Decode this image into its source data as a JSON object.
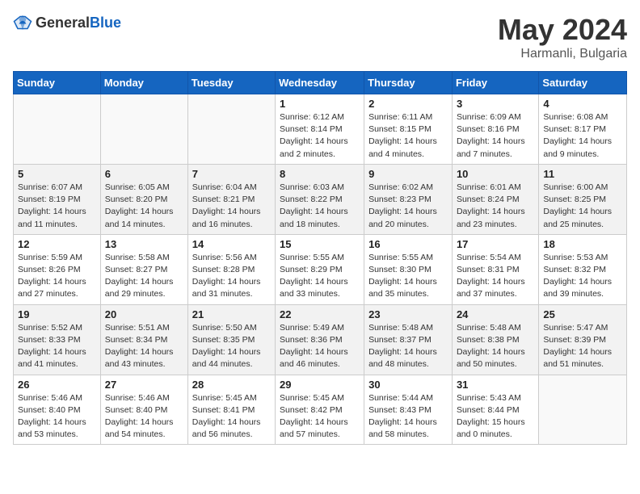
{
  "header": {
    "logo_general": "General",
    "logo_blue": "Blue",
    "month": "May 2024",
    "location": "Harmanli, Bulgaria"
  },
  "weekdays": [
    "Sunday",
    "Monday",
    "Tuesday",
    "Wednesday",
    "Thursday",
    "Friday",
    "Saturday"
  ],
  "weeks": [
    [
      {
        "day": "",
        "info": ""
      },
      {
        "day": "",
        "info": ""
      },
      {
        "day": "",
        "info": ""
      },
      {
        "day": "1",
        "info": "Sunrise: 6:12 AM\nSunset: 8:14 PM\nDaylight: 14 hours\nand 2 minutes."
      },
      {
        "day": "2",
        "info": "Sunrise: 6:11 AM\nSunset: 8:15 PM\nDaylight: 14 hours\nand 4 minutes."
      },
      {
        "day": "3",
        "info": "Sunrise: 6:09 AM\nSunset: 8:16 PM\nDaylight: 14 hours\nand 7 minutes."
      },
      {
        "day": "4",
        "info": "Sunrise: 6:08 AM\nSunset: 8:17 PM\nDaylight: 14 hours\nand 9 minutes."
      }
    ],
    [
      {
        "day": "5",
        "info": "Sunrise: 6:07 AM\nSunset: 8:19 PM\nDaylight: 14 hours\nand 11 minutes."
      },
      {
        "day": "6",
        "info": "Sunrise: 6:05 AM\nSunset: 8:20 PM\nDaylight: 14 hours\nand 14 minutes."
      },
      {
        "day": "7",
        "info": "Sunrise: 6:04 AM\nSunset: 8:21 PM\nDaylight: 14 hours\nand 16 minutes."
      },
      {
        "day": "8",
        "info": "Sunrise: 6:03 AM\nSunset: 8:22 PM\nDaylight: 14 hours\nand 18 minutes."
      },
      {
        "day": "9",
        "info": "Sunrise: 6:02 AM\nSunset: 8:23 PM\nDaylight: 14 hours\nand 20 minutes."
      },
      {
        "day": "10",
        "info": "Sunrise: 6:01 AM\nSunset: 8:24 PM\nDaylight: 14 hours\nand 23 minutes."
      },
      {
        "day": "11",
        "info": "Sunrise: 6:00 AM\nSunset: 8:25 PM\nDaylight: 14 hours\nand 25 minutes."
      }
    ],
    [
      {
        "day": "12",
        "info": "Sunrise: 5:59 AM\nSunset: 8:26 PM\nDaylight: 14 hours\nand 27 minutes."
      },
      {
        "day": "13",
        "info": "Sunrise: 5:58 AM\nSunset: 8:27 PM\nDaylight: 14 hours\nand 29 minutes."
      },
      {
        "day": "14",
        "info": "Sunrise: 5:56 AM\nSunset: 8:28 PM\nDaylight: 14 hours\nand 31 minutes."
      },
      {
        "day": "15",
        "info": "Sunrise: 5:55 AM\nSunset: 8:29 PM\nDaylight: 14 hours\nand 33 minutes."
      },
      {
        "day": "16",
        "info": "Sunrise: 5:55 AM\nSunset: 8:30 PM\nDaylight: 14 hours\nand 35 minutes."
      },
      {
        "day": "17",
        "info": "Sunrise: 5:54 AM\nSunset: 8:31 PM\nDaylight: 14 hours\nand 37 minutes."
      },
      {
        "day": "18",
        "info": "Sunrise: 5:53 AM\nSunset: 8:32 PM\nDaylight: 14 hours\nand 39 minutes."
      }
    ],
    [
      {
        "day": "19",
        "info": "Sunrise: 5:52 AM\nSunset: 8:33 PM\nDaylight: 14 hours\nand 41 minutes."
      },
      {
        "day": "20",
        "info": "Sunrise: 5:51 AM\nSunset: 8:34 PM\nDaylight: 14 hours\nand 43 minutes."
      },
      {
        "day": "21",
        "info": "Sunrise: 5:50 AM\nSunset: 8:35 PM\nDaylight: 14 hours\nand 44 minutes."
      },
      {
        "day": "22",
        "info": "Sunrise: 5:49 AM\nSunset: 8:36 PM\nDaylight: 14 hours\nand 46 minutes."
      },
      {
        "day": "23",
        "info": "Sunrise: 5:48 AM\nSunset: 8:37 PM\nDaylight: 14 hours\nand 48 minutes."
      },
      {
        "day": "24",
        "info": "Sunrise: 5:48 AM\nSunset: 8:38 PM\nDaylight: 14 hours\nand 50 minutes."
      },
      {
        "day": "25",
        "info": "Sunrise: 5:47 AM\nSunset: 8:39 PM\nDaylight: 14 hours\nand 51 minutes."
      }
    ],
    [
      {
        "day": "26",
        "info": "Sunrise: 5:46 AM\nSunset: 8:40 PM\nDaylight: 14 hours\nand 53 minutes."
      },
      {
        "day": "27",
        "info": "Sunrise: 5:46 AM\nSunset: 8:40 PM\nDaylight: 14 hours\nand 54 minutes."
      },
      {
        "day": "28",
        "info": "Sunrise: 5:45 AM\nSunset: 8:41 PM\nDaylight: 14 hours\nand 56 minutes."
      },
      {
        "day": "29",
        "info": "Sunrise: 5:45 AM\nSunset: 8:42 PM\nDaylight: 14 hours\nand 57 minutes."
      },
      {
        "day": "30",
        "info": "Sunrise: 5:44 AM\nSunset: 8:43 PM\nDaylight: 14 hours\nand 58 minutes."
      },
      {
        "day": "31",
        "info": "Sunrise: 5:43 AM\nSunset: 8:44 PM\nDaylight: 15 hours\nand 0 minutes."
      },
      {
        "day": "",
        "info": ""
      }
    ]
  ]
}
